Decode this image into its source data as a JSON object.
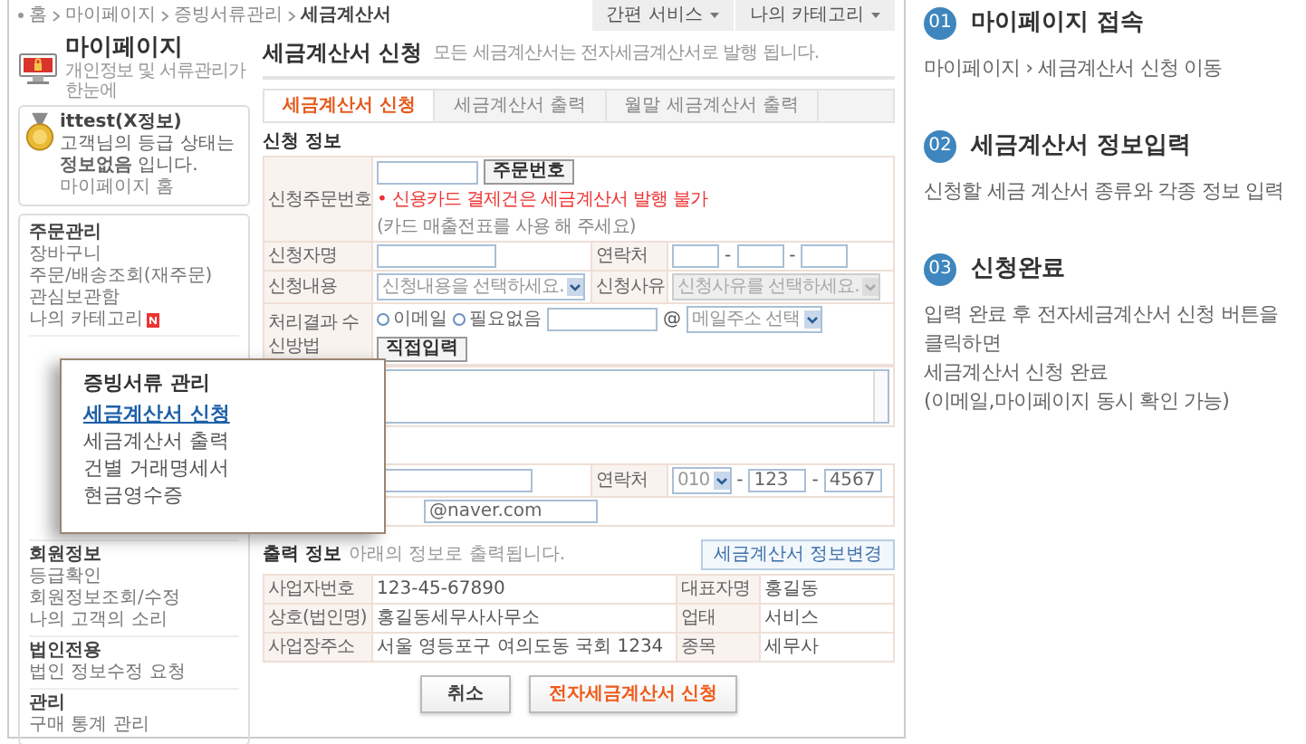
{
  "breadcrumb": [
    {
      "label": "홈",
      "current": false
    },
    {
      "label": "마이페이지",
      "current": false
    },
    {
      "label": "증빙서류관리",
      "current": false
    },
    {
      "label": "세금계산서",
      "current": true
    }
  ],
  "top_buttons": [
    "간편 서비스",
    "나의 카테고리"
  ],
  "logo": {
    "title": "마이페이지",
    "subtitle": "개인정보 및 서류관리가 한눈에"
  },
  "profile": {
    "user": "ittest(X정보)",
    "grade_text": "고객님의 등급 상태는 **정보없음** 입니다.",
    "home_link": "마이페이지 홈"
  },
  "sidebar": [
    {
      "title": "주문관리",
      "items": [
        {
          "label": "장바구니",
          "new": false
        },
        {
          "label": "주문/배송조회(재주문)",
          "new": false
        },
        {
          "label": "관심보관함",
          "new": false
        },
        {
          "label": "나의 카테고리",
          "new": true
        }
      ]
    },
    {
      "title": "회원정보",
      "items": [
        {
          "label": "등급확인",
          "new": false
        },
        {
          "label": "회원정보조회/수정",
          "new": false
        },
        {
          "label": "나의 고객의 소리",
          "new": false
        }
      ]
    },
    {
      "title": "법인전용",
      "items": [
        {
          "label": "법인 정보수정 요청",
          "new": false
        }
      ]
    },
    {
      "title": "관리",
      "items": [
        {
          "label": "구매 통계 관리",
          "new": false
        }
      ]
    }
  ],
  "page": {
    "title": "세금계산서 신청",
    "note": "모든 세금계산서는 전자세금계산서로 발행 됩니다."
  },
  "tabs": [
    {
      "label": "세금계산서 신청",
      "selected": true
    },
    {
      "label": "세금계산서 출력",
      "selected": false
    },
    {
      "label": "월말 세금계산서 출력",
      "selected": false
    }
  ],
  "request_form": {
    "title": "신청 정보",
    "order_no": {
      "label": "신청주문번호",
      "button": "주문번호",
      "warning": "• 신용카드 결제건은 세금계산서 발행 불가",
      "hint": "(카드 매출전표를 사용 해 주세요)"
    },
    "applicant": {
      "label": "신청자명"
    },
    "contact": {
      "label": "연락처",
      "separator": "-"
    },
    "content": {
      "label": "신청내용",
      "placeholder": "신청내용을 선택하세요.",
      "disabled": false
    },
    "reason": {
      "label": "신청사유",
      "placeholder": "신청사유를 선택하세요.",
      "disabled": true
    },
    "delivery": {
      "label": "처리결과 수신방법",
      "options": [
        {
          "label": "이메일",
          "selected": false
        },
        {
          "label": "필요없음",
          "selected": false
        }
      ],
      "at": "@",
      "domain": "메일주소 선택",
      "button": "직접입력"
    }
  },
  "applicant_info": {
    "contact_label": "연락처",
    "phone": [
      "010",
      "123",
      "4567"
    ],
    "separator": "-",
    "email": "@naver.com"
  },
  "output": {
    "title": "출력 정보",
    "note": "아래의 정보로 출력됩니다.",
    "button": "세금계산서 정보변경",
    "rows": [
      {
        "label": "사업자번호",
        "value": "123-45-67890",
        "label_2": "대표자명",
        "value_2": "홍길동"
      },
      {
        "label": "상호(법인명)",
        "value": "홍길동세무사사무소",
        "label_2": "업태",
        "value_2": "서비스"
      },
      {
        "label": "사업장주소",
        "value": "서울 영등포구 여의도동 국회 1234",
        "label_2": "종목",
        "value_2": "세무사"
      }
    ]
  },
  "actions": [
    {
      "label": "취소",
      "kind": "default"
    },
    {
      "label": "전자세금계산서 신청",
      "kind": "primary"
    }
  ],
  "popup": {
    "title": "증빙서류 관리",
    "items": [
      {
        "label": "세금계산서 신청",
        "selected": true
      },
      {
        "label": "세금계산서 출력",
        "selected": false
      },
      {
        "label": "건별 거래명세서",
        "selected": false
      },
      {
        "label": "현금영수증",
        "selected": false
      }
    ]
  },
  "steps": [
    {
      "number": "01",
      "title": "마이페이지 접속",
      "lines": [
        "마이페이지 › 세금계산서 신청 이동"
      ]
    },
    {
      "number": "02",
      "title": "세금계산서 정보입력",
      "lines": [
        "신청할 세금 계산서 종류와 각종 정보 입력"
      ]
    },
    {
      "number": "03",
      "title": "신청완료",
      "lines": [
        "입력 완료 후 전자세금계산서 신청 버튼을 클릭하면",
        "세금계산서 신청 완료",
        "(이메일,마이페이지 동시 확인 가능)"
      ]
    }
  ]
}
